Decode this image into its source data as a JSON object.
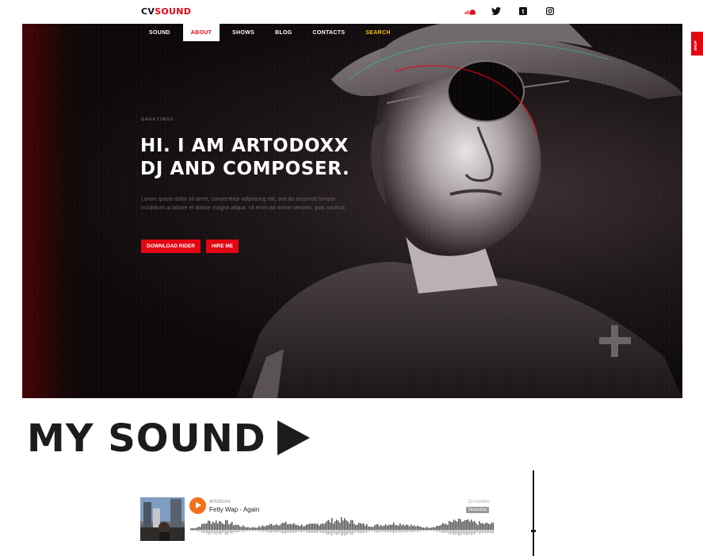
{
  "logo": {
    "part1": "CV",
    "part2": "SOUND"
  },
  "social": [
    {
      "name": "soundcloud-icon",
      "glyph": "☁"
    },
    {
      "name": "twitter-icon",
      "glyph": "🐦"
    },
    {
      "name": "tumblr-icon",
      "glyph": "t"
    },
    {
      "name": "instagram-icon",
      "glyph": "◙"
    }
  ],
  "nav": {
    "items": [
      "SOUND",
      "ABOUT",
      "SHOWS",
      "BLOG",
      "CONTACTS",
      "SEARCH"
    ],
    "active": "ABOUT"
  },
  "hero": {
    "greeting": "GREETINGS",
    "headline_line1": "HI. I AM ARTODOXX",
    "headline_line2": "DJ AND COMPOSER.",
    "body": "Lorem ipsum dolor sit amet, consectetur adipiscing elit, sed do eiusmod tempor incididunt ut labore et dolore magna aliqua. Ut enim ad minim veniam, quis nostrud.",
    "buttons": {
      "download": "DOWNLOAD RIDER",
      "hire": "HIRE ME"
    }
  },
  "side_tab": {
    "label": "SHOP"
  },
  "section": {
    "title": "MY SOUND"
  },
  "player": {
    "artist": "artodoxx",
    "track": "Fetty Wap - Again",
    "posted": "10 months",
    "tag": "#industrial"
  },
  "colors": {
    "accent": "#e30613",
    "soundcloud": "#f26f1b",
    "search": "#f5c518"
  }
}
